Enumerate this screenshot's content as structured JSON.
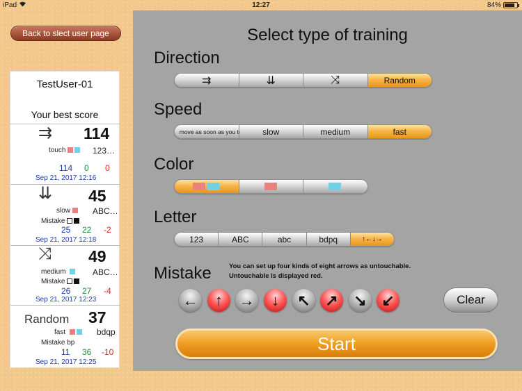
{
  "status_bar": {
    "device": "iPad",
    "time": "12:27",
    "battery": "84%",
    "battery_level": 0.84
  },
  "back_button": "Back to  slect user page",
  "score_panel": {
    "user": "TestUser-01",
    "best_label": "Your best score",
    "entries": [
      {
        "symbol": "⇉",
        "score": "114",
        "setting": "touch",
        "letters": "123…",
        "mistake_label": "",
        "values": [
          "114",
          "0",
          "0"
        ],
        "date": "Sep 21, 2017 12:16"
      },
      {
        "symbol": "⇊",
        "score": "45",
        "setting": "slow",
        "letters": "ABC…",
        "mistake_label": "Mistake",
        "values": [
          "25",
          "22",
          "-2"
        ],
        "date": "Sep 21, 2017 12:18"
      },
      {
        "symbol": "⤨",
        "score": "49",
        "setting": "medium",
        "letters": "ABC…",
        "mistake_label": "Mistake",
        "values": [
          "26",
          "27",
          "-4"
        ],
        "date": "Sep 21, 2017 12:23"
      },
      {
        "symbol": "Random",
        "score": "37",
        "setting": "fast",
        "letters": "bdqp",
        "mistake_label": "Mistake  bp",
        "values": [
          "11",
          "36",
          "-10"
        ],
        "date": "Sep 21, 2017 12:25"
      }
    ]
  },
  "main": {
    "title": "Select type of training",
    "direction": {
      "label": "Direction",
      "options": [
        "⇉",
        "⇊",
        "⤨",
        "Random"
      ],
      "selected": 3
    },
    "speed": {
      "label": "Speed",
      "options": [
        "move as soon as you touch",
        "slow",
        "medium",
        "fast"
      ],
      "selected": 3
    },
    "color": {
      "label": "Color",
      "selected": 0
    },
    "letter": {
      "label": "Letter",
      "options": [
        "123",
        "ABC",
        "abc",
        "bdpq",
        "↑←↓→"
      ],
      "selected": 4
    },
    "mistake": {
      "label": "Mistake",
      "note_line1": "You can set up four kinds of eight arrows as untouchable.",
      "note_line2": "Untouchable is displayed red.",
      "arrows": [
        {
          "glyph": "←",
          "untouchable": false
        },
        {
          "glyph": "↑",
          "untouchable": true
        },
        {
          "glyph": "→",
          "untouchable": false
        },
        {
          "glyph": "↓",
          "untouchable": true
        },
        {
          "glyph": "↖",
          "untouchable": false
        },
        {
          "glyph": "↗",
          "untouchable": true
        },
        {
          "glyph": "↘",
          "untouchable": false
        },
        {
          "glyph": "↙",
          "untouchable": true
        }
      ]
    },
    "clear_label": "Clear",
    "start_label": "Start"
  },
  "colors": {
    "accent_orange": "#ef9d22",
    "untouchable_red": "#ff5a5a",
    "panel_gray": "#a4a4a4",
    "background": "#f3c88d"
  }
}
